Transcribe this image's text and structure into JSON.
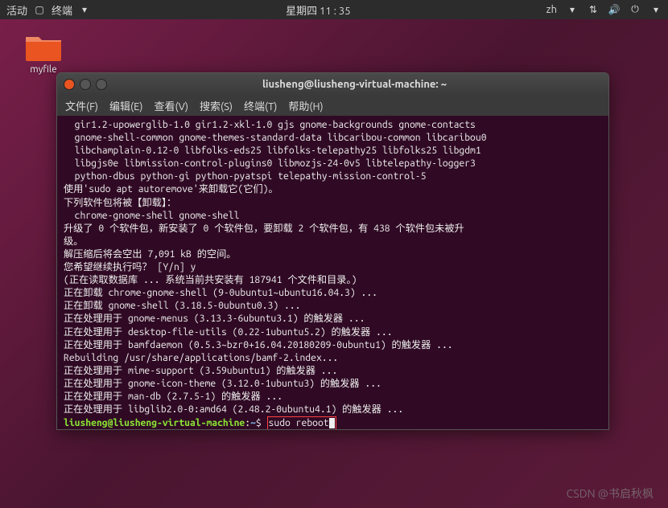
{
  "topbar": {
    "activities": "活动",
    "app_indicator": "终端",
    "clock": "星期四 11 : 35",
    "lang": "zh"
  },
  "desktop": {
    "folder_label": "myfile"
  },
  "terminal": {
    "title": "liusheng@liusheng-virtual-machine: ~",
    "menu": {
      "file": "文件(F)",
      "edit": "编辑(E)",
      "view": "查看(V)",
      "search": "搜索(S)",
      "terminal": "终端(T)",
      "help": "帮助(H)"
    },
    "lines": [
      "  gir1.2-upowerglib-1.0 gir1.2-xkl-1.0 gjs gnome-backgrounds gnome-contacts",
      "  gnome-shell-common gnome-themes-standard-data libcaribou-common libcaribou0",
      "  libchamplain-0.12-0 libfolks-eds25 libfolks-telepathy25 libfolks25 libgdm1",
      "  libgjs0e libmission-control-plugins0 libmozjs-24-0v5 libtelepathy-logger3",
      "  python-dbus python-gi python-pyatspi telepathy-mission-control-5",
      "使用'sudo apt autoremove'来卸载它(它们)。",
      "下列软件包将被【卸载】：",
      "  chrome-gnome-shell gnome-shell",
      "升级了 0 个软件包，新安装了 0 个软件包，要卸载 2 个软件包，有 438 个软件包未被升",
      "级。",
      "解压缩后将会空出 7,091 kB 的空间。",
      "您希望继续执行吗？ [Y/n] y",
      "(正在读取数据库 ... 系统当前共安装有 187941 个文件和目录。)",
      "正在卸载 chrome-gnome-shell (9-0ubuntu1~ubuntu16.04.3) ...",
      "正在卸载 gnome-shell (3.18.5-0ubuntu0.3) ...",
      "正在处理用于 gnome-menus (3.13.3-6ubuntu3.1) 的触发器 ...",
      "正在处理用于 desktop-file-utils (0.22-1ubuntu5.2) 的触发器 ...",
      "正在处理用于 bamfdaemon (0.5.3~bzr0+16.04.20180209-0ubuntu1) 的触发器 ...",
      "Rebuilding /usr/share/applications/bamf-2.index...",
      "正在处理用于 mime-support (3.59ubuntu1) 的触发器 ...",
      "正在处理用于 gnome-icon-theme (3.12.0-1ubuntu3) 的触发器 ...",
      "正在处理用于 man-db (2.7.5-1) 的触发器 ...",
      "正在处理用于 libglib2.0-0:amd64 (2.48.2-0ubuntu4.1) 的触发器 ..."
    ],
    "prompt": {
      "user_host": "liusheng@liusheng-virtual-machine",
      "sep1": ":",
      "path": "~",
      "sep2": "$",
      "command": "sudo reboot"
    }
  },
  "watermark": "CSDN @书启秋枫"
}
